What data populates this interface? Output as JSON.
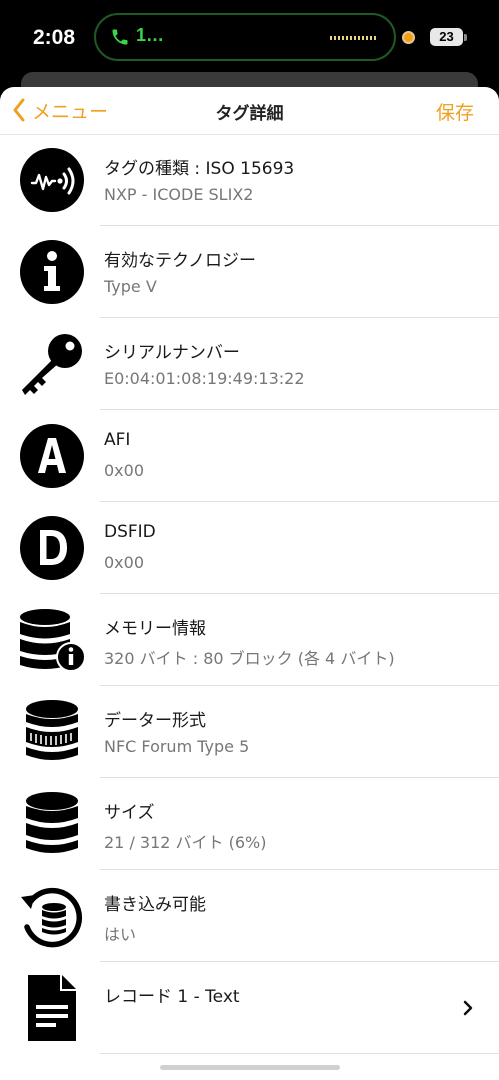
{
  "status_bar": {
    "time": "2:08",
    "call_indicator": "1…",
    "battery": "23",
    "icons": [
      "phone-call-icon",
      "waveform-icon",
      "recording-dot-icon",
      "battery-icon"
    ]
  },
  "nav": {
    "back_label": "メニュー",
    "title": "タグ詳細",
    "save_label": "保存",
    "accent_color": "#F0A020"
  },
  "rows": [
    {
      "icon": "nfc-tag-icon",
      "title": "タグの種類 : ISO 15693",
      "subtitle": "NXP - ICODE SLIX2"
    },
    {
      "icon": "info-icon",
      "title": "有効なテクノロジー",
      "subtitle": "Type V"
    },
    {
      "icon": "key-icon",
      "title": "シリアルナンバー",
      "subtitle": "E0:04:01:08:19:49:13:22"
    },
    {
      "icon": "letter-a-icon",
      "title": "AFI",
      "subtitle": "0x00"
    },
    {
      "icon": "letter-d-icon",
      "title": "DSFID",
      "subtitle": "0x00"
    },
    {
      "icon": "database-info-icon",
      "title": "メモリー情報",
      "subtitle": "320 バイト : 80 ブロック (各 4 バイト)"
    },
    {
      "icon": "database-icon",
      "title": "データー形式",
      "subtitle": "NFC Forum Type 5"
    },
    {
      "icon": "database-stack-icon",
      "title": "サイズ",
      "subtitle": "21 / 312 バイト (6%)"
    },
    {
      "icon": "database-refresh-icon",
      "title": "書き込み可能",
      "subtitle": "はい"
    },
    {
      "icon": "document-icon",
      "title": "レコード 1 - Text",
      "subtitle": ""
    }
  ]
}
